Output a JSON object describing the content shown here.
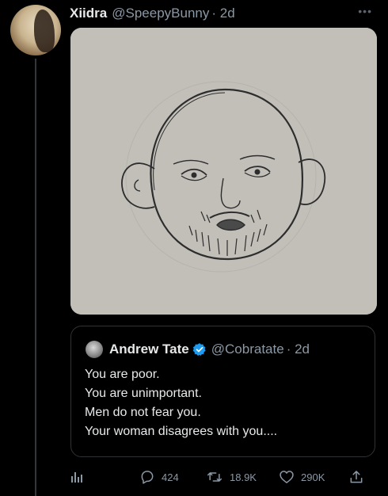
{
  "tweet": {
    "author_name": "Xiidra",
    "author_handle": "@SpeepyBunny",
    "time": "· 2d",
    "more_icon": "ellipsis-icon"
  },
  "quoted_tweet": {
    "author_name": "Andrew Tate",
    "author_handle": "@Cobratate",
    "time": "· 2d",
    "verified_icon": "verified-badge-icon",
    "lines": [
      "You are poor.",
      "You are unimportant.",
      "Men do not fear you.",
      "Your woman disagrees with you...."
    ]
  },
  "actions": {
    "analytics_icon": "analytics-icon",
    "replies": "424",
    "retweets": "18.9K",
    "likes": "290K",
    "share_icon": "share-icon"
  },
  "colors": {
    "background": "#000000",
    "text_primary": "#e7e9ea",
    "text_secondary": "#8b98a5",
    "verified_blue": "#1d9bf0"
  }
}
